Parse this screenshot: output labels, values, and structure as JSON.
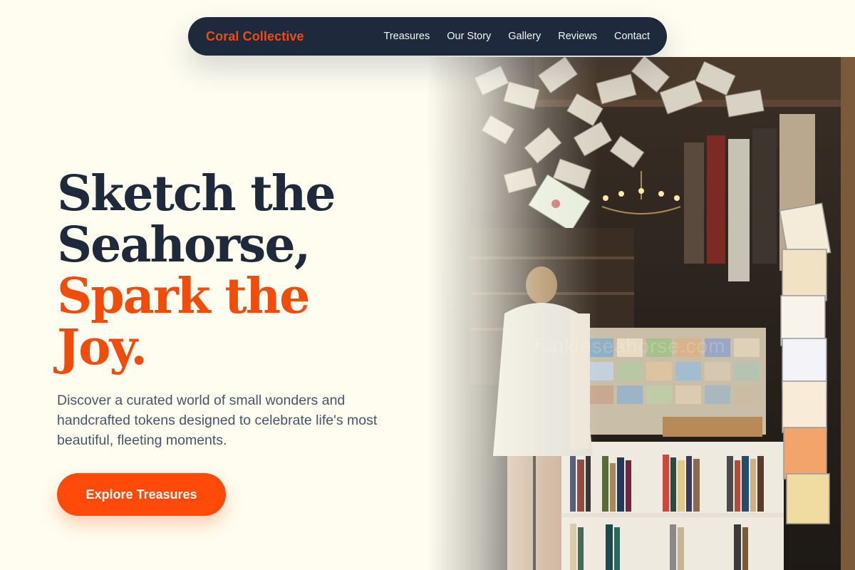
{
  "brand": {
    "name": "Coral Collective"
  },
  "nav": {
    "items": [
      {
        "label": "Treasures"
      },
      {
        "label": "Our Story"
      },
      {
        "label": "Gallery"
      },
      {
        "label": "Reviews"
      },
      {
        "label": "Contact"
      }
    ]
  },
  "hero": {
    "title_line1": "Sketch the",
    "title_line2": "Seahorse,",
    "title_line3": "Spark the",
    "title_line4": "Joy.",
    "subtitle": "Discover a curated world of small wonders and handcrafted tokens designed to celebrate life's most beautiful, fleeting moments.",
    "cta_label": "Explore Treasures",
    "image_watermark": "funkieseahorse.com"
  },
  "colors": {
    "background": "#fefdf0",
    "navy": "#1e293b",
    "accent": "#f04d0c",
    "cta": "#ff4a0a",
    "body_text": "#475569"
  }
}
